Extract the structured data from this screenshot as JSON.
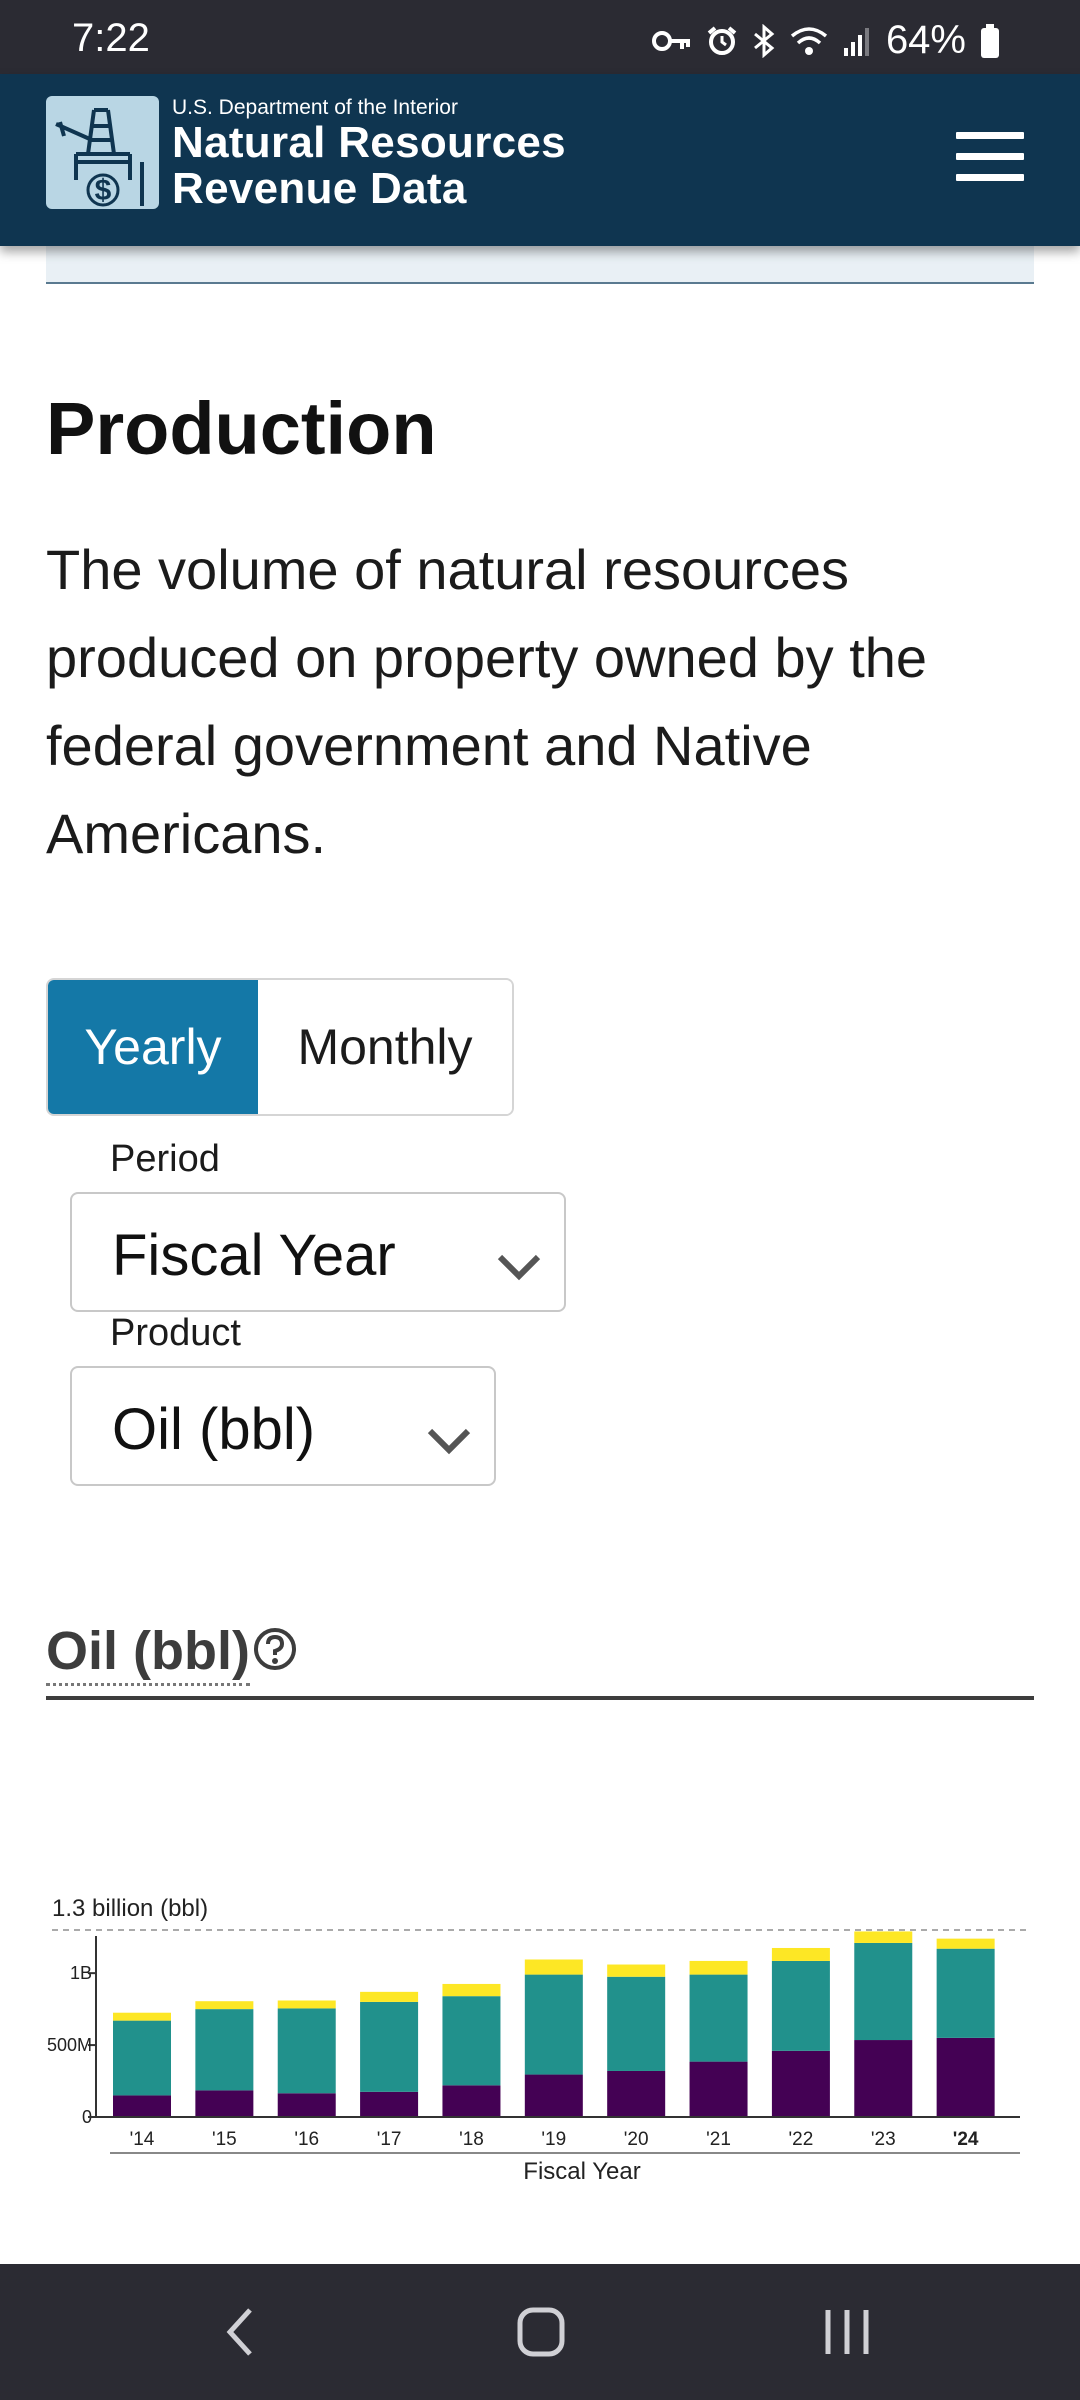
{
  "status_bar": {
    "time": "7:22",
    "battery": "64%"
  },
  "header": {
    "department": "U.S. Department of the Interior",
    "title_line1": "Natural Resources",
    "title_line2": "Revenue Data"
  },
  "main": {
    "title": "Production",
    "description": "The volume of natural resources produced on property owned by the federal government and Native Americans.",
    "toggle": {
      "yearly": "Yearly",
      "monthly": "Monthly",
      "selected": "Yearly"
    },
    "period": {
      "label": "Period",
      "value": "Fiscal Year"
    },
    "product": {
      "label": "Product",
      "value": "Oil (bbl)"
    },
    "chart_heading": "Oil (bbl)"
  },
  "colors": {
    "header_bg": "#0f3550",
    "toggle_active": "#1478a7",
    "series_bottom": "#440154",
    "series_middle": "#21918c",
    "series_top": "#fde725"
  },
  "chart_data": {
    "type": "bar",
    "stacked": true,
    "max_label": "1.3 billion (bbl)",
    "xlabel": "Fiscal Year",
    "ylabel": "",
    "ylim": [
      0,
      1300000000
    ],
    "y_ticks": [
      {
        "value": 0,
        "label": "0"
      },
      {
        "value": 500000000,
        "label": "500M"
      },
      {
        "value": 1000000000,
        "label": "1B"
      }
    ],
    "categories": [
      "'14",
      "'15",
      "'16",
      "'17",
      "'18",
      "'19",
      "'20",
      "'21",
      "'22",
      "'23",
      "'24"
    ],
    "highlighted_category": "'24",
    "series": [
      {
        "color": "#440154",
        "values": [
          150000000,
          185000000,
          165000000,
          175000000,
          220000000,
          295000000,
          320000000,
          385000000,
          460000000,
          535000000,
          550000000
        ]
      },
      {
        "color": "#21918c",
        "values": [
          520000000,
          565000000,
          590000000,
          625000000,
          620000000,
          695000000,
          655000000,
          605000000,
          625000000,
          675000000,
          620000000
        ]
      },
      {
        "color": "#fde725",
        "values": [
          55000000,
          55000000,
          55000000,
          70000000,
          85000000,
          105000000,
          85000000,
          95000000,
          90000000,
          80000000,
          70000000
        ]
      }
    ]
  }
}
